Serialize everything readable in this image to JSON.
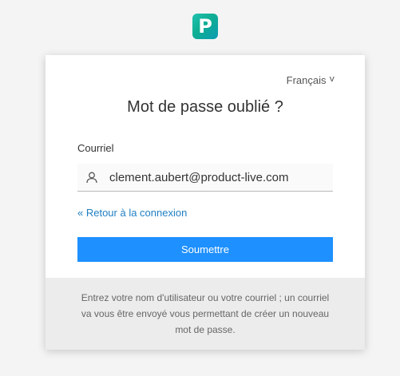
{
  "brand": {
    "logo_letter": "P",
    "logo_icon": "product-live-logo"
  },
  "header": {
    "language": "Français",
    "language_icon": "chevron-down-icon"
  },
  "form": {
    "title": "Mot de passe oublié ?",
    "email_label": "Courriel",
    "email_value": "clement.aubert@product-live.com",
    "user_icon": "user-icon",
    "back_link": "« Retour à la connexion",
    "submit_label": "Soumettre"
  },
  "footer": {
    "help_text": "Entrez votre nom d'utilisateur ou votre courriel ; un courriel va vous être envoyé vous permettant de créer un nouveau mot de passe."
  },
  "colors": {
    "accent": "#1e90ff",
    "link": "#1f7fc4",
    "brand": "#14b39a",
    "background": "#f4f4f4",
    "footer_bg": "#ececec"
  }
}
